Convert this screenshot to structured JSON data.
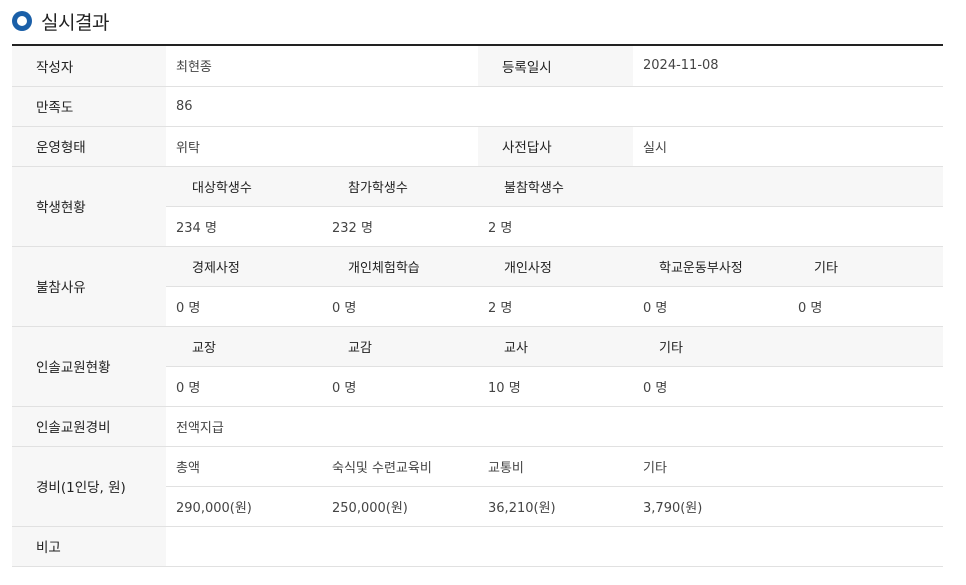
{
  "section_title": "실시결과",
  "rows": {
    "author": {
      "label": "작성자",
      "value": "최현종"
    },
    "reg_date": {
      "label": "등록일시",
      "value": "2024-11-08"
    },
    "satisfaction": {
      "label": "만족도",
      "value": "86"
    },
    "operation": {
      "label": "운영형태",
      "value": "위탁"
    },
    "survey": {
      "label": "사전답사",
      "value": "실시"
    },
    "students": {
      "label": "학생현황",
      "headers": [
        "대상학생수",
        "참가학생수",
        "불참학생수"
      ],
      "values": [
        "234 명",
        "232 명",
        "2 명"
      ]
    },
    "absence": {
      "label": "불참사유",
      "headers": [
        "경제사정",
        "개인체험학습",
        "개인사정",
        "학교운동부사정",
        "기타"
      ],
      "values": [
        "0 명",
        "0 명",
        "2 명",
        "0 명",
        "0 명"
      ]
    },
    "teachers": {
      "label": "인솔교원현황",
      "headers": [
        "교장",
        "교감",
        "교사",
        "기타"
      ],
      "values": [
        "0 명",
        "0 명",
        "10 명",
        "0 명"
      ]
    },
    "teacher_cost": {
      "label": "인솔교원경비",
      "value": "전액지급"
    },
    "cost": {
      "label": "경비(1인당, 원)",
      "headers": [
        "총액",
        "숙식및 수련교육비",
        "교통비",
        "기타"
      ],
      "values": [
        "290,000(원)",
        "250,000(원)",
        "36,210(원)",
        "3,790(원)"
      ]
    },
    "note": {
      "label": "비고",
      "value": ""
    }
  }
}
